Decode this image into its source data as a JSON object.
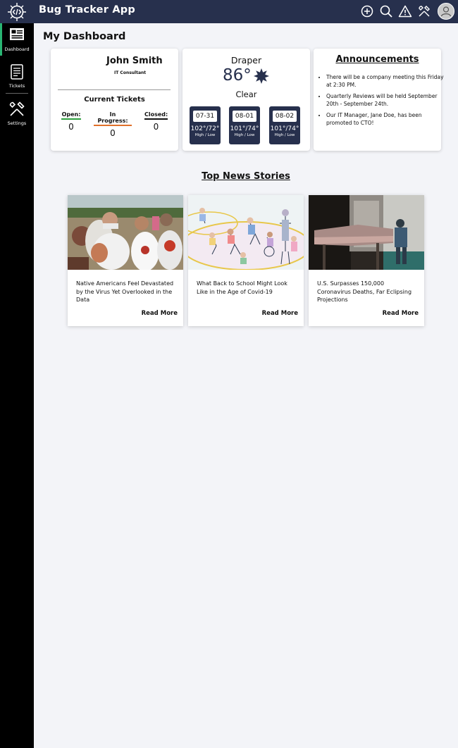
{
  "app": {
    "title": "Bug Tracker App"
  },
  "topbar": {
    "icons": [
      "add-icon",
      "search-icon",
      "alert-icon",
      "tools-icon",
      "user-avatar"
    ]
  },
  "sidebar": {
    "items": [
      {
        "label": "Dashboard",
        "icon": "dashboard-icon",
        "active": true
      },
      {
        "label": "Tickets",
        "icon": "tickets-icon",
        "active": false
      },
      {
        "label": "Settings",
        "icon": "settings-icon",
        "active": false
      }
    ]
  },
  "page": {
    "title": "My Dashboard"
  },
  "user": {
    "name": "John Smith",
    "role": "IT Consultant"
  },
  "tickets": {
    "title": "Current Tickets",
    "open": {
      "label": "Open:",
      "count": "0",
      "color": "#2e9e3e"
    },
    "in_progress": {
      "label": "In Progress:",
      "count": "0",
      "color": "#e0702a"
    },
    "closed": {
      "label": "Closed:",
      "count": "0",
      "color": "#111111"
    }
  },
  "weather": {
    "city": "Draper",
    "temp": "86°",
    "condition": "Clear",
    "forecast": [
      {
        "date": "07-31",
        "temps": "102°/72°",
        "label": "High / Low"
      },
      {
        "date": "08-01",
        "temps": "101°/74°",
        "label": "High / Low"
      },
      {
        "date": "08-02",
        "temps": "101°/74°",
        "label": "High / Low"
      }
    ]
  },
  "announcements": {
    "title": "Announcements",
    "items": [
      "There will be a company meeting this Friday at 2:30 PM.",
      "Quarterly Reviews will be held September 20th - September 24th.",
      "Our IT Manager, Jane Doe, has been promoted to CTO!"
    ]
  },
  "news": {
    "title": "Top News Stories",
    "stories": [
      {
        "headline": "Native Americans Feel Devastated by the Virus Yet Overlooked in the Data",
        "more": "Read More"
      },
      {
        "headline": "What Back to School Might Look Like in the Age of Covid-19",
        "more": "Read More"
      },
      {
        "headline": "U.S. Surpasses 150,000 Coronavirus Deaths, Far Eclipsing Projections",
        "more": "Read More"
      }
    ]
  },
  "colors": {
    "navy": "#27304d",
    "accent_active": "#29b573",
    "background": "#f3f4f8"
  }
}
